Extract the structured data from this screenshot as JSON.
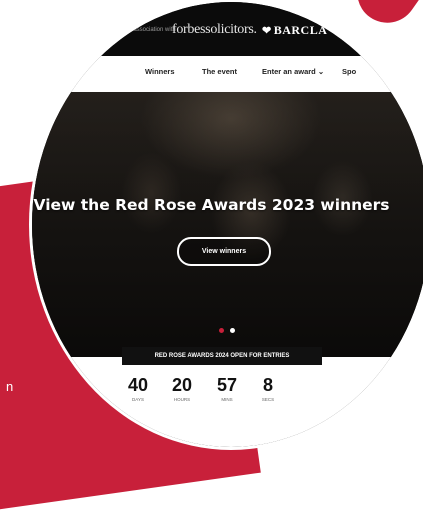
{
  "partner_prefix": "in association with",
  "logos": {
    "primary": "forbessolicitors.",
    "secondary": "BARCLA"
  },
  "nav": [
    "Winners",
    "The event",
    "Enter an award ⌄",
    "Spo"
  ],
  "hero": {
    "title": "View the Red Rose Awards 2023 winners",
    "button_label": "View winners"
  },
  "slider": {
    "total_slides": 2,
    "active_index": 0
  },
  "countdown": {
    "banner": "RED ROSE AWARDS 2024 OPEN FOR ENTRIES",
    "units": [
      {
        "value": "40",
        "label": "DAYS"
      },
      {
        "value": "20",
        "label": "HOURS"
      },
      {
        "value": "57",
        "label": "MINS"
      },
      {
        "value": "8",
        "label": "SECS"
      }
    ]
  },
  "background_text": [
    "n",
    ""
  ],
  "colors": {
    "accent_red": "#c8203a",
    "dark": "#0b0b0b",
    "white": "#ffffff"
  }
}
